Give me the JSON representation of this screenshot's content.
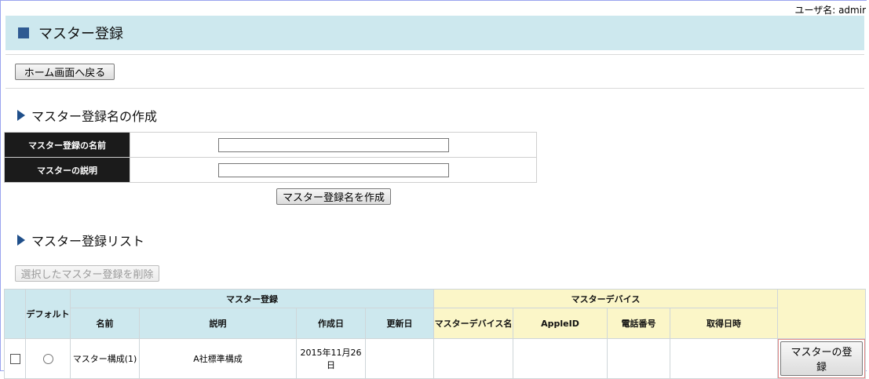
{
  "header": {
    "user_label": "ユーザ名: admir",
    "title": "マスター登録"
  },
  "buttons": {
    "home": "ホーム画面へ戻る",
    "create": "マスター登録名を作成",
    "delete_selected": "選択したマスター登録を削除",
    "register_master": "マスターの登録"
  },
  "create_section": {
    "heading": "マスター登録名の作成",
    "fields": [
      {
        "label": "マスター登録の名前",
        "value": ""
      },
      {
        "label": "マスターの説明",
        "value": ""
      }
    ]
  },
  "list_section": {
    "heading": "マスター登録リスト",
    "group_headers": {
      "master_registration": "マスター登録",
      "master_device": "マスターデバイス"
    },
    "columns": {
      "default": "デフォルト",
      "name": "名前",
      "description": "説明",
      "created": "作成日",
      "updated": "更新日",
      "device_name": "マスターデバイス名",
      "apple_id": "AppleID",
      "phone": "電話番号",
      "acquired": "取得日時"
    },
    "rows": [
      {
        "name": "マスター構成(1)",
        "description": "A社標準構成",
        "created": "2015年11月26日",
        "updated": "",
        "device_name": "",
        "apple_id": "",
        "phone": "",
        "acquired": ""
      }
    ]
  },
  "colors": {
    "title_bar_bg": "#cde8ee",
    "title_square": "#2f5a92",
    "section_arrow": "#1f4f8a",
    "label_cell_bg": "#1b1b1b",
    "device_header_bg": "#fbf6c8"
  }
}
